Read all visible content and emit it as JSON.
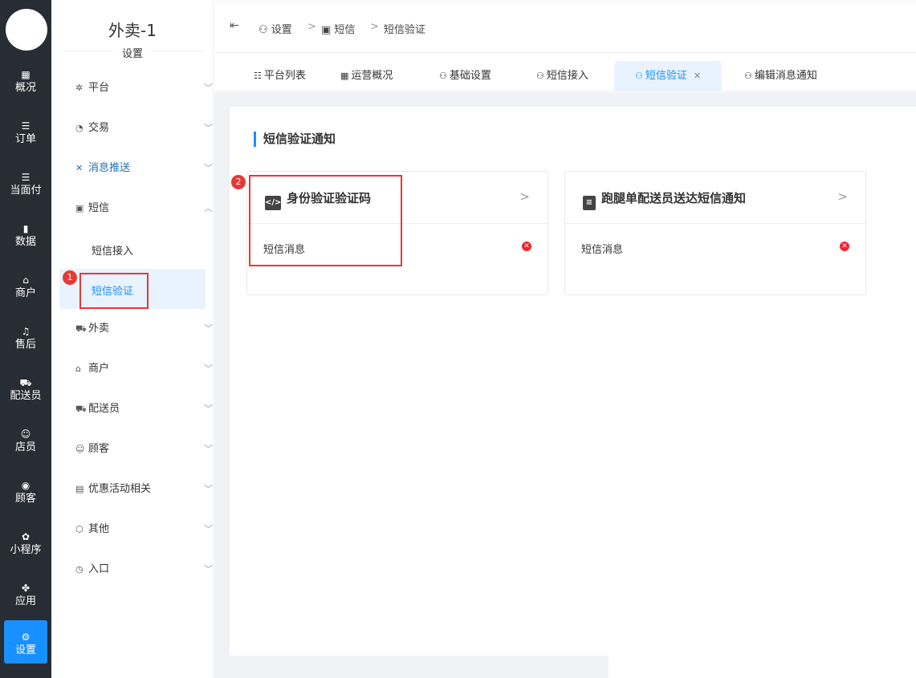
{
  "rail": {
    "items": [
      {
        "icon": "grid-icon",
        "glyph": "▦",
        "label": "概况"
      },
      {
        "icon": "list-icon",
        "glyph": "☰",
        "label": "订单"
      },
      {
        "icon": "list-icon",
        "glyph": "☰",
        "label": "当面付"
      },
      {
        "icon": "bar-chart-icon",
        "glyph": "▮",
        "label": "数据"
      },
      {
        "icon": "store-icon",
        "glyph": "⌂",
        "label": "商户"
      },
      {
        "icon": "headset-icon",
        "glyph": "♫",
        "label": "售后"
      },
      {
        "icon": "delivery-icon",
        "glyph": "⛟",
        "label": "配送员"
      },
      {
        "icon": "users-icon",
        "glyph": "☺",
        "label": "店员"
      },
      {
        "icon": "user-circle-icon",
        "glyph": "◉",
        "label": "顾客"
      },
      {
        "icon": "wechat-icon",
        "glyph": "✿",
        "label": "小程序"
      },
      {
        "icon": "apps-icon",
        "glyph": "✤",
        "label": "应用"
      },
      {
        "icon": "settings-icon",
        "glyph": "⚙",
        "label": "设置"
      }
    ]
  },
  "sidebar": {
    "title": "外卖-1",
    "subtitle": "设置",
    "items": [
      {
        "icon": "gear-icon",
        "glyph": "✲",
        "label": "平台"
      },
      {
        "icon": "trade-icon",
        "glyph": "◔",
        "label": "交易"
      },
      {
        "icon": "push-icon",
        "glyph": "✕",
        "label": "消息推送"
      },
      {
        "icon": "sms-icon",
        "glyph": "▣",
        "label": "短信"
      },
      {
        "icon": "takeout-icon",
        "glyph": "⛟",
        "label": "外卖"
      },
      {
        "icon": "store-icon",
        "glyph": "⌂",
        "label": "商户"
      },
      {
        "icon": "courier-icon",
        "glyph": "⛟",
        "label": "配送员"
      },
      {
        "icon": "customer-icon",
        "glyph": "☺",
        "label": "顾客"
      },
      {
        "icon": "gift-icon",
        "glyph": "▤",
        "label": "优惠活动相关"
      },
      {
        "icon": "hexagon-icon",
        "glyph": "⬡",
        "label": "其他"
      },
      {
        "icon": "compass-icon",
        "glyph": "◷",
        "label": "入口"
      }
    ],
    "sms_sub": [
      "短信接入",
      "短信验证"
    ]
  },
  "annotations": {
    "badge1": "1",
    "badge2": "2"
  },
  "breadcrumb": {
    "items": [
      "设置",
      "短信",
      "短信验证"
    ],
    "sep": ">"
  },
  "tabs": [
    {
      "icon": "list-icon",
      "glyph": "☷",
      "label": "平台列表"
    },
    {
      "icon": "grid-icon",
      "glyph": "▦",
      "label": "运营概况"
    },
    {
      "icon": "user-gear-icon",
      "glyph": "⚇",
      "label": "基础设置"
    },
    {
      "icon": "user-gear-icon",
      "glyph": "⚇",
      "label": "短信接入"
    },
    {
      "icon": "user-gear-icon",
      "glyph": "⚇",
      "label": "短信验证"
    },
    {
      "icon": "user-gear-icon",
      "glyph": "⚇",
      "label": "编辑消息通知"
    }
  ],
  "main": {
    "section_title": "短信验证通知",
    "cards": [
      {
        "title": "身份验证验证码",
        "icon": "code-icon",
        "glyph": "</>",
        "message": "短信消息"
      },
      {
        "title": "跑腿单配送员送达短信通知",
        "icon": "clipboard-icon",
        "glyph": "≡",
        "message": "短信消息"
      }
    ]
  },
  "colors": {
    "rail_bg": "#282c34",
    "accent": "#1890ff",
    "annotation": "#e53935",
    "error": "#f5222d"
  }
}
